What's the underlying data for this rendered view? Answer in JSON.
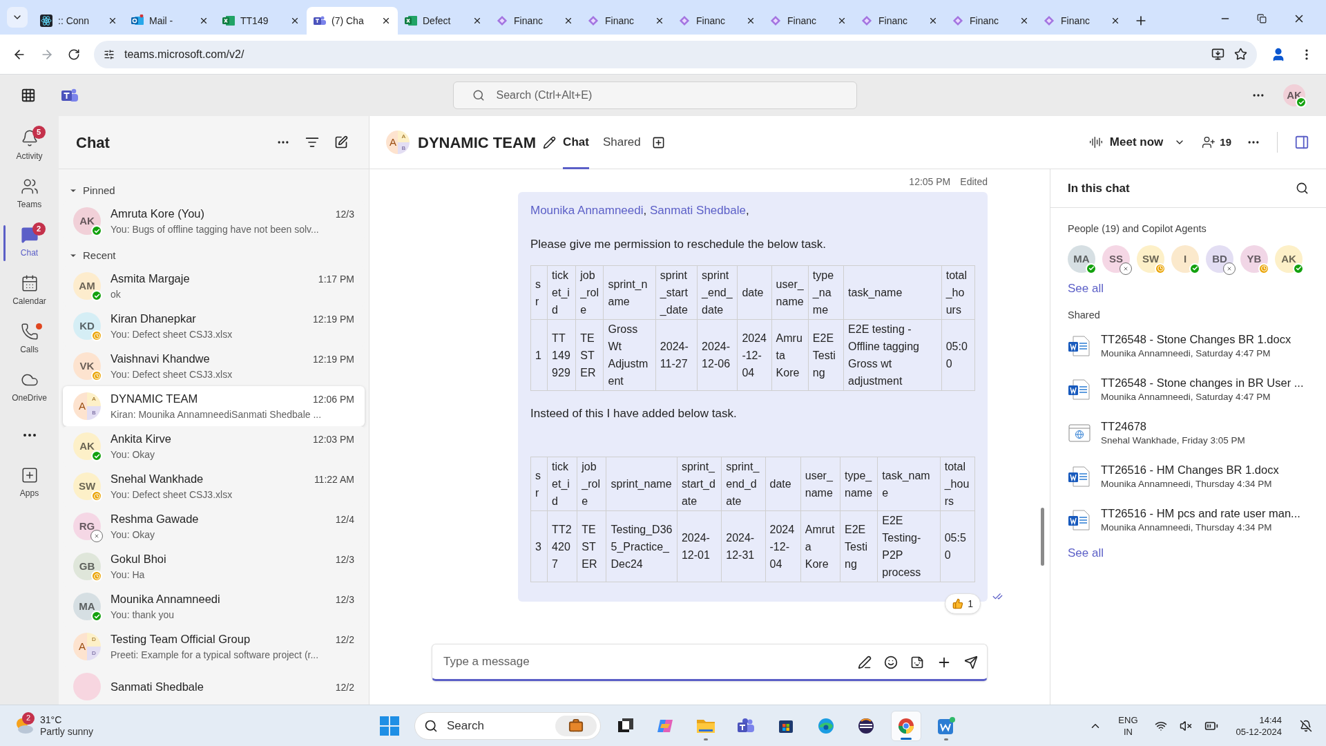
{
  "browser": {
    "tabs": [
      {
        "title": ":: Conn",
        "kind": "atom",
        "selected": false
      },
      {
        "title": "Mail - ",
        "kind": "mail",
        "selected": false
      },
      {
        "title": "TT149",
        "kind": "sheet",
        "selected": false
      },
      {
        "title": "(7) Cha",
        "kind": "people",
        "selected": true
      },
      {
        "title": "Defect",
        "kind": "sheet",
        "selected": false
      },
      {
        "title": "Financ",
        "kind": "diamond",
        "selected": false
      },
      {
        "title": "Financ",
        "kind": "diamond",
        "selected": false
      },
      {
        "title": "Financ",
        "kind": "diamond",
        "selected": false
      },
      {
        "title": "Financ",
        "kind": "diamond",
        "selected": false
      },
      {
        "title": "Financ",
        "kind": "diamond",
        "selected": false
      },
      {
        "title": "Financ",
        "kind": "diamond",
        "selected": false
      },
      {
        "title": "Financ",
        "kind": "diamond",
        "selected": false
      }
    ],
    "url": "teams.microsoft.com/v2/"
  },
  "top_bar": {
    "search": {
      "placeholder": "Search (Ctrl+Alt+E)"
    },
    "avatar": {
      "initials": "AK",
      "color": "#f1d0d8",
      "away": false,
      "offline": false
    }
  },
  "rail": [
    {
      "kind": "bell",
      "label": "Activity",
      "badge": "5",
      "dot": false,
      "selected": false
    },
    {
      "kind": "teams",
      "label": "Teams",
      "dot": false,
      "selected": false
    },
    {
      "kind": "chat",
      "label": "Chat",
      "badge": "2",
      "dot": false,
      "selected": true
    },
    {
      "kind": "calendar",
      "label": "Calendar",
      "dot": false,
      "selected": false
    },
    {
      "kind": "phone",
      "label": "Calls",
      "dot": true,
      "selected": false
    },
    {
      "kind": "cloud",
      "label": "OneDrive",
      "dot": false,
      "selected": false
    },
    {
      "kind": "more"
    },
    {
      "kind": "apps",
      "label": "Apps",
      "dot": false,
      "selected": false
    }
  ],
  "chat_list": {
    "title": "Chat",
    "sections": [
      {
        "label": "Pinned",
        "expanded": true,
        "chats": [
          {
            "kind": "person",
            "initials": "AK",
            "color": "#f1d0d8",
            "away": false,
            "offline": false,
            "name": "Amruta Kore (You)",
            "time": "12/3",
            "preview": "You: Bugs of offline tagging have not been solv...",
            "selected": false
          }
        ]
      },
      {
        "label": "Recent",
        "expanded": true,
        "chats": [
          {
            "kind": "person",
            "initials": "AM",
            "color": "#fdeccd",
            "away": false,
            "offline": false,
            "name": "Asmita Margaje",
            "time": "1:17 PM",
            "preview": "ok",
            "selected": false
          },
          {
            "kind": "person",
            "initials": "KD",
            "color": "#d5eef5",
            "away": true,
            "offline": false,
            "name": "Kiran Dhanepkar",
            "time": "12:19 PM",
            "preview": "You: Defect sheet CSJ3.xlsx",
            "selected": false
          },
          {
            "kind": "person",
            "initials": "VK",
            "color": "#fde3cf",
            "away": true,
            "offline": false,
            "name": "Vaishnavi Khandwe",
            "time": "12:19 PM",
            "preview": "You: Defect sheet CSJ3.xlsx",
            "selected": false
          },
          {
            "kind": "group",
            "letters": [
              "A",
              "A",
              "B"
            ],
            "name": "DYNAMIC TEAM",
            "time": "12:06 PM",
            "preview": "Kiran: Mounika AnnamneediSanmati Shedbale ...",
            "selected": true
          },
          {
            "kind": "person",
            "initials": "AK",
            "color": "#fdf0c8",
            "away": false,
            "offline": false,
            "name": "Ankita Kirve",
            "time": "12:03 PM",
            "preview": "You: Okay",
            "selected": false
          },
          {
            "kind": "person",
            "initials": "SW",
            "color": "#fdf0c8",
            "away": true,
            "offline": false,
            "name": "Snehal Wankhade",
            "time": "11:22 AM",
            "preview": "You: Defect sheet CSJ3.xlsx",
            "selected": false
          },
          {
            "kind": "person",
            "initials": "RG",
            "color": "#f5d7e5",
            "away": false,
            "offline": true,
            "name": "Reshma Gawade",
            "time": "12/4",
            "preview": "You: Okay",
            "selected": false
          },
          {
            "kind": "person",
            "initials": "GB",
            "color": "#dfe6da",
            "away": true,
            "offline": false,
            "name": "Gokul Bhoi",
            "time": "12/3",
            "preview": "You: Ha",
            "selected": false
          },
          {
            "kind": "person",
            "initials": "MA",
            "color": "#d6dfe3",
            "away": false,
            "offline": false,
            "name": "Mounika Annamneedi",
            "time": "12/3",
            "preview": "You: thank you",
            "selected": false
          },
          {
            "kind": "group",
            "letters": [
              "A",
              "D",
              "D"
            ],
            "name": "Testing Team Official Group",
            "time": "12/2",
            "preview": "Preeti: Example for a typical software project (r...",
            "selected": false
          },
          {
            "kind": "partial",
            "color": "#f7d6e0",
            "name": "Sanmati Shedbale",
            "time": "12/2",
            "selected": false
          }
        ]
      }
    ]
  },
  "header": {
    "letters": [
      "A",
      "A",
      "B"
    ],
    "title": "DYNAMIC TEAM",
    "tabs": [
      {
        "label": "Chat",
        "selected": true
      },
      {
        "label": "Shared",
        "selected": false
      }
    ],
    "meet_now": "Meet now",
    "participants": "19"
  },
  "message": {
    "time": "12:05 PM",
    "edited": "Edited",
    "blocks": [
      {
        "kind": "mentions",
        "names": [
          "Mounika Annamneedi",
          "Sanmati Shedbale"
        ],
        "separator": ","
      },
      {
        "kind": "text",
        "text": "Please give me permission to reschedule the below task."
      },
      {
        "kind": "table",
        "columns": [
          "sr",
          "ticket_id",
          "job_role",
          "sprint_name",
          "sprint_start_date",
          "sprint_end_date",
          "date",
          "user_name",
          "type_name",
          "task_name",
          "total_hours"
        ],
        "rows": [
          [
            "1",
            "TT149929",
            "TESTER",
            "Gross Wt Adjustment",
            "2024-11-27",
            "2024-12-06",
            "2024-12-04",
            "Amruta Kore",
            "E2E Testing",
            "E2E testing - Offline tagging Gross wt adjustment",
            "05:00"
          ]
        ]
      },
      {
        "kind": "text",
        "text": "Insteed of this I have added below task."
      },
      {
        "kind": "table",
        "columns": [
          "sr",
          "ticket_id",
          "job_role",
          "sprint_name",
          "sprint_start_date",
          "sprint_end_date",
          "date",
          "user_name",
          "type_name",
          "task_name",
          "total_hours"
        ],
        "rows": [
          [
            "3",
            "TT24207",
            "TESTER",
            "Testing_D365_Practice_Dec24",
            "2024-12-01",
            "2024-12-31",
            "2024-12-04",
            "Amruta Kore",
            "E2E Testing",
            "E2E Testing-P2P process",
            "05:50"
          ]
        ]
      }
    ],
    "reaction": {
      "count": "1"
    }
  },
  "composer": {
    "placeholder": "Type a message"
  },
  "side_panel": {
    "title": "In this chat",
    "people_label": "People (19) and Copilot Agents",
    "people": [
      {
        "initials": "MA",
        "color": "#d6dfe3",
        "away": false,
        "offline": false
      },
      {
        "initials": "SS",
        "color": "#f5d7e5",
        "away": false,
        "offline": true
      },
      {
        "initials": "SW",
        "color": "#fdf0c8",
        "away": true,
        "offline": false
      },
      {
        "initials": "I",
        "color": "#fbe9cc",
        "away": false,
        "offline": false
      },
      {
        "initials": "BD",
        "color": "#e3def3",
        "away": false,
        "offline": true
      },
      {
        "initials": "YB",
        "color": "#f1d6e6",
        "away": true,
        "offline": false
      },
      {
        "initials": "AK",
        "color": "#fdf0c8",
        "away": false,
        "offline": false
      }
    ],
    "people_link": "See all",
    "shared_label": "Shared",
    "files": [
      {
        "kind": "word",
        "name": "TT26548 - Stone Changes BR 1.docx",
        "meta": "Mounika Annamneedi, Saturday 4:47 PM"
      },
      {
        "kind": "word",
        "name": "TT26548 - Stone changes in BR User ...",
        "meta": "Mounika Annamneedi, Saturday 4:47 PM"
      },
      {
        "kind": "web",
        "name": "TT24678",
        "meta": "Snehal Wankhade, Friday 3:05 PM"
      },
      {
        "kind": "word",
        "name": "TT26516 - HM Changes BR 1.docx",
        "meta": "Mounika Annamneedi, Thursday 4:34 PM"
      },
      {
        "kind": "word",
        "name": "TT26516 - HM pcs and rate user man...",
        "meta": "Mounika Annamneedi, Thursday 4:34 PM"
      }
    ],
    "files_link": "See all"
  },
  "taskbar": {
    "weather": {
      "badge": "2",
      "temp": "31°C",
      "desc": "Partly sunny"
    },
    "search": {
      "placeholder": "Search"
    },
    "apps": [
      {
        "kind": "square",
        "active": false,
        "running": false
      },
      {
        "kind": "copilot",
        "active": false,
        "running": false
      },
      {
        "kind": "folder",
        "active": false,
        "running": true
      },
      {
        "kind": "teams",
        "active": false,
        "running": false
      },
      {
        "kind": "store",
        "active": false,
        "running": false
      },
      {
        "kind": "edge",
        "active": false,
        "running": false
      },
      {
        "kind": "eclipse",
        "active": false,
        "running": false
      },
      {
        "kind": "chrome",
        "active": true,
        "running": true
      },
      {
        "kind": "wapp",
        "active": false,
        "running": true
      }
    ],
    "lang": [
      "ENG",
      "IN"
    ],
    "time": "14:44",
    "date": "05-12-2024"
  }
}
